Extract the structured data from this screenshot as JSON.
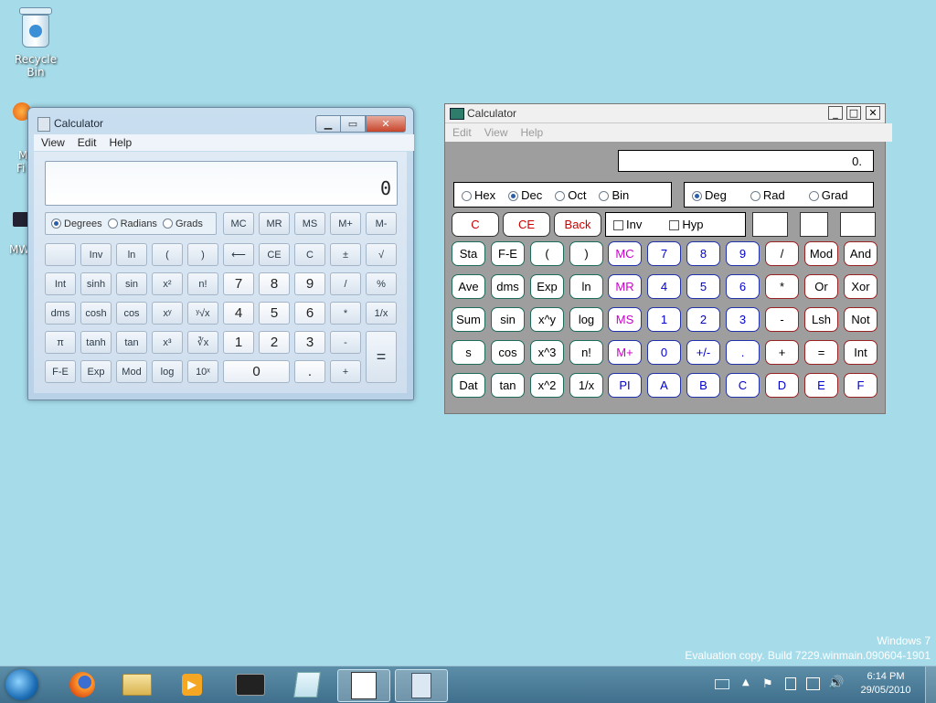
{
  "desktop": {
    "icons": [
      {
        "label": "Recycle Bin"
      }
    ],
    "partial_labels": [
      "M",
      "Fi",
      "MW"
    ],
    "watermark": {
      "line1": "Windows 7",
      "line2": "Evaluation copy. Build 7229.winmain.090604-1901"
    }
  },
  "win7_calc": {
    "title": "Calculator",
    "menu": [
      "View",
      "Edit",
      "Help"
    ],
    "display": "0",
    "angle_modes": [
      {
        "label": "Degrees",
        "selected": true
      },
      {
        "label": "Radians",
        "selected": false
      },
      {
        "label": "Grads",
        "selected": false
      }
    ],
    "memory_row": [
      "MC",
      "MR",
      "MS",
      "M+",
      "M-"
    ],
    "rows": [
      [
        "",
        "Inv",
        "ln",
        "(",
        ")",
        "⟵",
        "CE",
        "C",
        "±",
        "√"
      ],
      [
        "Int",
        "sinh",
        "sin",
        "x²",
        "n!",
        "7",
        "8",
        "9",
        "/",
        "%"
      ],
      [
        "dms",
        "cosh",
        "cos",
        "xʸ",
        "ʸ√x",
        "4",
        "5",
        "6",
        "*",
        "1/x"
      ],
      [
        "π",
        "tanh",
        "tan",
        "x³",
        "∛x",
        "1",
        "2",
        "3",
        "-",
        "="
      ],
      [
        "F-E",
        "Exp",
        "Mod",
        "log",
        "10ˣ",
        "0",
        ".",
        "+"
      ]
    ]
  },
  "xp_calc": {
    "title": "Calculator",
    "menu": [
      "Edit",
      "View",
      "Help"
    ],
    "display": "0.",
    "bases": [
      {
        "label": "Hex",
        "selected": false
      },
      {
        "label": "Dec",
        "selected": true
      },
      {
        "label": "Oct",
        "selected": false
      },
      {
        "label": "Bin",
        "selected": false
      }
    ],
    "angles": [
      {
        "label": "Deg",
        "selected": true
      },
      {
        "label": "Rad",
        "selected": false
      },
      {
        "label": "Grad",
        "selected": false
      }
    ],
    "control_buttons": [
      "C",
      "CE",
      "Back"
    ],
    "checkboxes": [
      "Inv",
      "Hyp"
    ],
    "grid": [
      [
        "Sta",
        "F-E",
        "(",
        ")",
        "MC",
        "7",
        "8",
        "9",
        "/",
        "Mod",
        "And"
      ],
      [
        "Ave",
        "dms",
        "Exp",
        "ln",
        "MR",
        "4",
        "5",
        "6",
        "*",
        "Or",
        "Xor"
      ],
      [
        "Sum",
        "sin",
        "x^y",
        "log",
        "MS",
        "1",
        "2",
        "3",
        "-",
        "Lsh",
        "Not"
      ],
      [
        "s",
        "cos",
        "x^3",
        "n!",
        "M+",
        "0",
        "+/-",
        ".",
        "+",
        "=",
        "Int"
      ],
      [
        "Dat",
        "tan",
        "x^2",
        "1/x",
        "PI",
        "A",
        "B",
        "C",
        "D",
        "E",
        "F"
      ]
    ]
  },
  "taskbar": {
    "clock_time": "6:14 PM",
    "clock_date": "29/05/2010"
  },
  "colors": {
    "desktop": "#a6dcea",
    "red_text": "#cc0000",
    "blue_text": "#0000cc",
    "magenta_text": "#cc00cc"
  }
}
